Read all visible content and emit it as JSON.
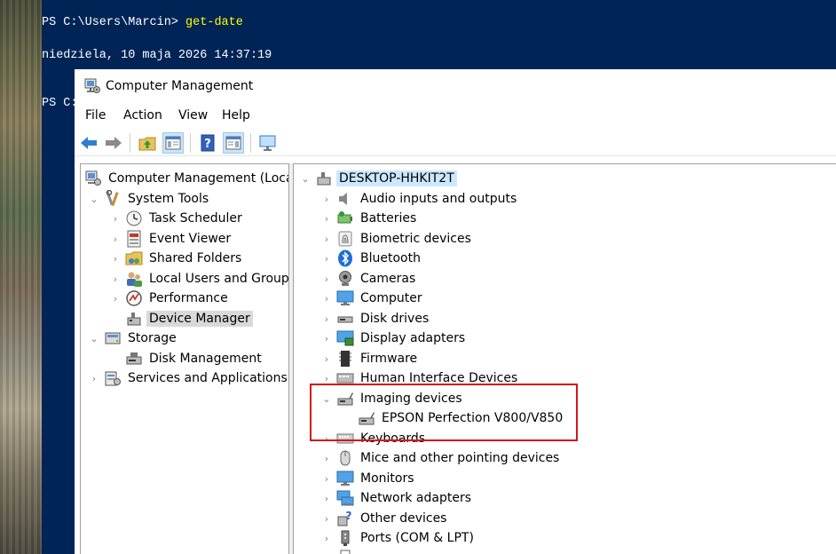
{
  "powershell": {
    "lines": [
      {
        "prompt": "PS C:\\Users\\Marcin>",
        "command": "get-date"
      },
      {
        "output": "niedziela, 10 maja 2026 14:37:19"
      },
      {
        "prompt": "PS C:"
      }
    ]
  },
  "window": {
    "title": "Computer Management",
    "menu": [
      "File",
      "Action",
      "View",
      "Help"
    ]
  },
  "toolbar": {
    "buttons": [
      "back-icon",
      "forward-icon",
      "up-folder-icon",
      "show-hide-tree-icon",
      "help-icon",
      "show-hide-action-pane-icon",
      "monitor-icon"
    ]
  },
  "tree": {
    "root": "Computer Management (Local)",
    "system_tools": "System Tools",
    "task_scheduler": "Task Scheduler",
    "event_viewer": "Event Viewer",
    "shared_folders": "Shared Folders",
    "local_users": "Local Users and Groups",
    "performance": "Performance",
    "device_manager": "Device Manager",
    "storage": "Storage",
    "disk_management": "Disk Management",
    "services": "Services and Applications"
  },
  "devices": {
    "computer_name": "DESKTOP-HHKIT2T",
    "categories": [
      "Audio inputs and outputs",
      "Batteries",
      "Biometric devices",
      "Bluetooth",
      "Cameras",
      "Computer",
      "Disk drives",
      "Display adapters",
      "Firmware",
      "Human Interface Devices",
      "Imaging devices",
      "Keyboards",
      "Mice and other pointing devices",
      "Monitors",
      "Network adapters",
      "Other devices",
      "Ports (COM & LPT)"
    ],
    "imaging_child": "EPSON Perfection V800/V850"
  },
  "colors": {
    "powershell_bg": "#012456",
    "command": "#ffff00",
    "highlight": "#d0161c",
    "selection": "#cce8ff"
  }
}
